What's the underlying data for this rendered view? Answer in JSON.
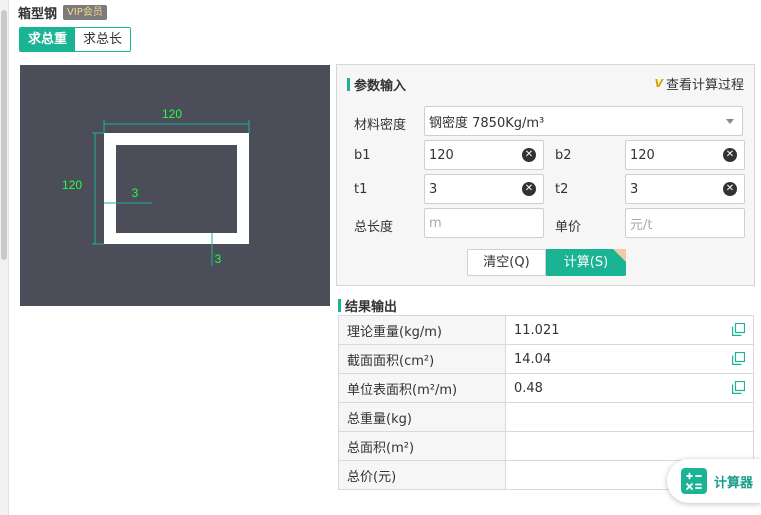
{
  "header": {
    "title": "箱型钢",
    "vip_badge": "VIP会员"
  },
  "mode_tabs": [
    {
      "label": "求总重",
      "active": true
    },
    {
      "label": "求总长",
      "active": false
    }
  ],
  "diagram": {
    "dim_width": "120",
    "dim_height": "120",
    "dim_t_left": "3",
    "dim_t_bottom": "3"
  },
  "params": {
    "title": "参数输入",
    "view_process": "查看计算过程",
    "density_label": "材料密度",
    "density_value": "钢密度 7850Kg/m³",
    "b1_label": "b1",
    "b1_value": "120",
    "b2_label": "b2",
    "b2_value": "120",
    "t1_label": "t1",
    "t1_value": "3",
    "t2_label": "t2",
    "t2_value": "3",
    "length_label": "总长度",
    "length_placeholder": "m",
    "price_label": "单价",
    "price_placeholder": "元/t",
    "clear_button": "清空(Q)",
    "calc_button": "计算(S)"
  },
  "results": {
    "title": "结果输出",
    "rows": [
      {
        "label": "理论重量(kg/m)",
        "value": "11.021",
        "copyable": true
      },
      {
        "label": "截面面积(cm²)",
        "value": "14.04",
        "copyable": true
      },
      {
        "label": "单位表面积(m²/m)",
        "value": "0.48",
        "copyable": true
      },
      {
        "label": "总重量(kg)",
        "value": "",
        "copyable": false
      },
      {
        "label": "总面积(m²)",
        "value": "",
        "copyable": false
      },
      {
        "label": "总价(元)",
        "value": "",
        "copyable": false
      }
    ]
  },
  "fab": {
    "label": "计算器"
  },
  "colors": {
    "accent": "#1ab394",
    "diagram_bg": "#4b4d59",
    "dim_line": "#1ab394",
    "dim_text": "#22ff44"
  }
}
